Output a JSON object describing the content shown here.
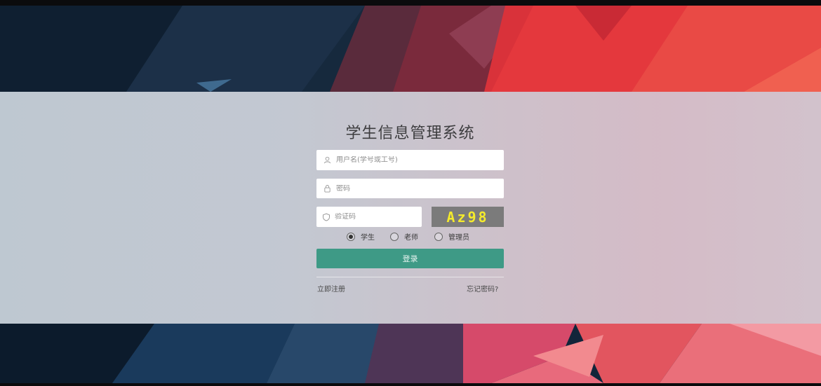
{
  "app": {
    "title": "学生信息管理系统"
  },
  "form": {
    "username_placeholder": "用户名(学号或工号)",
    "password_placeholder": "密码",
    "captcha_placeholder": "验证码",
    "captcha_text": "Az98",
    "roles": [
      {
        "label": "学生",
        "selected": true
      },
      {
        "label": "老师",
        "selected": false
      },
      {
        "label": "管理员",
        "selected": false
      }
    ],
    "login_label": "登录",
    "register_label": "立即注册",
    "forgot_label": "忘记密码?"
  },
  "colors": {
    "login_button": "#3e9a86",
    "captcha_bg": "#7b7b7b",
    "captcha_text": "#f4ea2c"
  }
}
